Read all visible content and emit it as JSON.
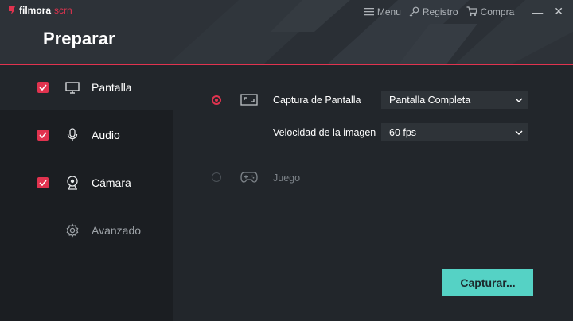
{
  "app": {
    "logo_brand": "filmora",
    "logo_product": "scrn",
    "title": "Preparar"
  },
  "topbar": {
    "menu_label": "Menu",
    "registro_label": "Registro",
    "compra_label": "Compra",
    "minimize_label": "—",
    "close_label": "✕"
  },
  "sidebar": {
    "items": [
      {
        "label": "Pantalla",
        "checked": true,
        "icon": "monitor-icon"
      },
      {
        "label": "Audio",
        "checked": true,
        "icon": "microphone-icon"
      },
      {
        "label": "Cámara",
        "checked": true,
        "icon": "webcam-icon"
      },
      {
        "label": "Avanzado",
        "icon": "gear-icon"
      }
    ]
  },
  "main": {
    "screen_option": {
      "label": "Captura de Pantalla",
      "selected": true,
      "select_value": "Pantalla Completa"
    },
    "framerate": {
      "label": "Velocidad de la imagen",
      "select_value": "60 fps"
    },
    "game_option": {
      "label": "Juego",
      "selected": false
    },
    "capture_button": "Capturar..."
  },
  "colors": {
    "accent": "#e1334f",
    "button": "#55d2c5",
    "header": "#2d3238",
    "sidebar": "#1b1e22",
    "panel": "#22262b"
  }
}
